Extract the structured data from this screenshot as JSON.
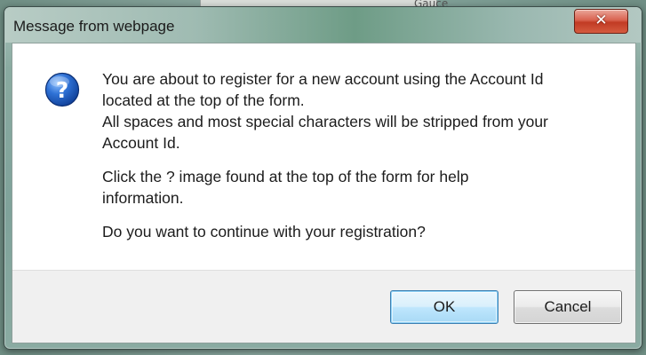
{
  "background": {
    "partial_text": "Gauce"
  },
  "dialog": {
    "title": "Message from webpage",
    "close_label": "✕",
    "icon": "question-icon",
    "paragraphs": [
      {
        "lines": [
          "You are about to register for a new account using the Account Id",
          "located at the top of the form.",
          "All spaces and most special characters will be stripped from your",
          "Account Id."
        ]
      },
      {
        "lines": [
          "Click the ? image found at the top of the form for help",
          "information."
        ]
      },
      {
        "lines": [
          "Do you want to continue with your registration?"
        ]
      }
    ],
    "buttons": {
      "ok_label": "OK",
      "cancel_label": "Cancel"
    }
  },
  "colors": {
    "title_bar": "#9fbbb2",
    "close_button": "#c13b24",
    "icon_blue": "#1f5fbf",
    "default_button_border": "#3c7fb1"
  }
}
